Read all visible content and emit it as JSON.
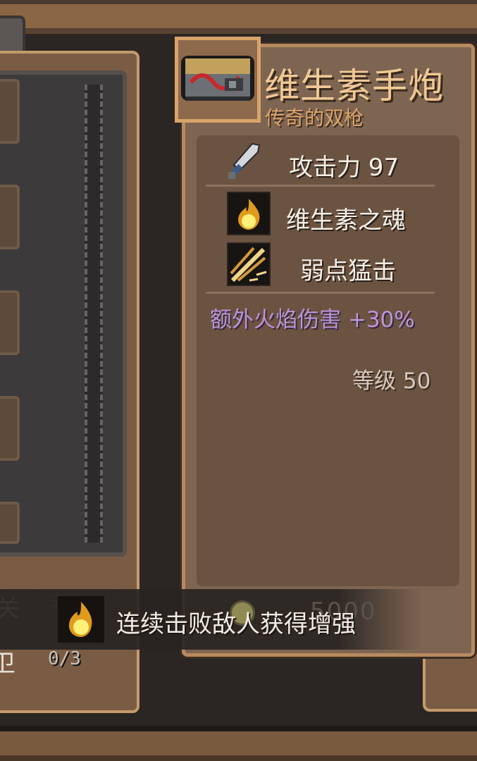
{
  "item": {
    "name": "维生素手炮",
    "rarity": "传奇的双枪",
    "icon": "hand-cannon-icon"
  },
  "stats": {
    "attack": "攻击力 97",
    "attack_icon": "sword-icon"
  },
  "abilities": [
    {
      "label": "维生素之魂",
      "icon": "vitamin-soul-flame-icon"
    },
    {
      "label": "弱点猛击",
      "icon": "weak-point-strike-icon"
    }
  ],
  "bonus": "额外火焰伤害 +30%",
  "level": "等级 50",
  "banner": {
    "text": "连续击败敌人获得增强",
    "icon": "vitamin-soul-flame-icon",
    "progress": "0/3"
  },
  "colors": {
    "title": "#f0c995",
    "rarity": "#d9a36a",
    "bonus": "#b995d6",
    "panel": "#7e6552"
  }
}
